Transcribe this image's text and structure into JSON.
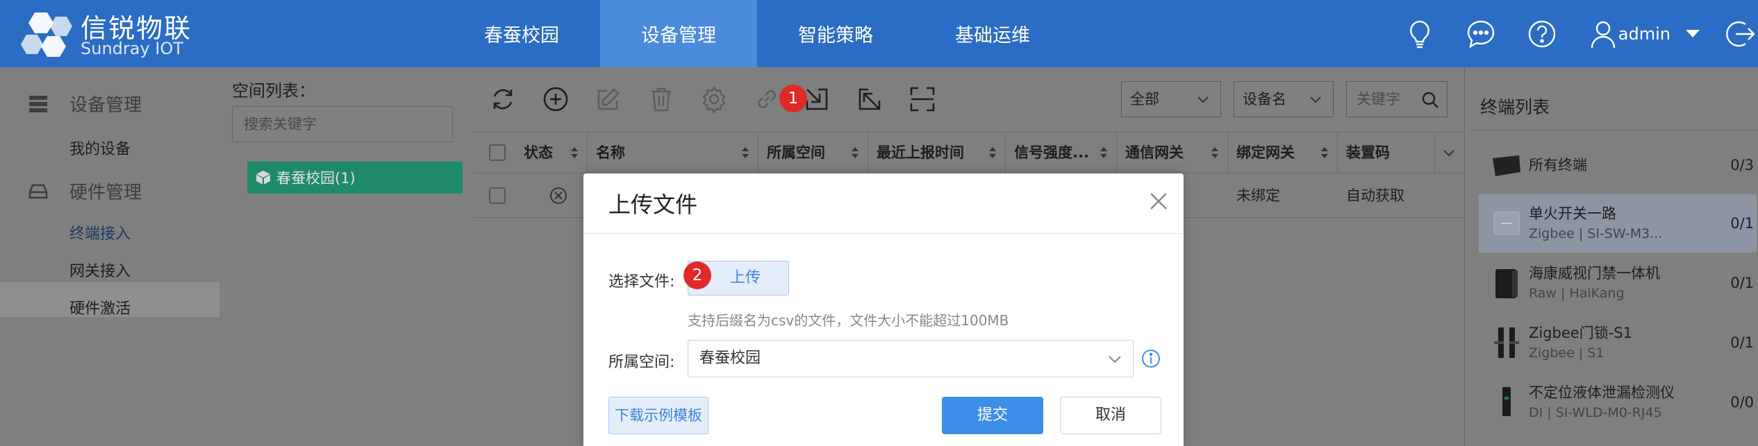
{
  "brand": {
    "name_cn": "信锐物联",
    "name_en": "Sundray IOT"
  },
  "nav": {
    "tabs": [
      {
        "label": "春蚕校园"
      },
      {
        "label": "设备管理",
        "active": true
      },
      {
        "label": "智能策略"
      },
      {
        "label": "基础运维"
      }
    ]
  },
  "header": {
    "user": "admin",
    "icons": [
      "lightbulb-icon",
      "chat-icon",
      "help-icon",
      "user-icon",
      "logout-icon"
    ]
  },
  "sidebar": {
    "groups": [
      {
        "label": "设备管理",
        "icon": "device-icon",
        "items": [
          {
            "label": "我的设备"
          }
        ]
      },
      {
        "label": "硬件管理",
        "icon": "hardware-icon",
        "items": [
          {
            "label": "终端接入",
            "active": true
          },
          {
            "label": "网关接入"
          },
          {
            "label": "硬件激活"
          }
        ]
      }
    ]
  },
  "space_panel": {
    "label": "空间列表：",
    "search_placeholder": "搜索关键字",
    "tree": [
      {
        "label": "春蚕校园(1)"
      }
    ]
  },
  "toolbar": {
    "icons": [
      "refresh-icon",
      "add-icon",
      "edit-icon",
      "delete-icon",
      "settings-icon",
      "link-icon",
      "import-icon",
      "export-icon",
      "scan-icon"
    ],
    "filter_all": "全部",
    "filter_field": "设备名",
    "keyword_placeholder": "关键字"
  },
  "table": {
    "columns": [
      "状态",
      "名称",
      "所属空间",
      "最近上报时间",
      "信号强度...",
      "通信网关",
      "绑定网关",
      "装置码"
    ],
    "rows": [
      {
        "status_icon": "offline-icon",
        "name": "",
        "space": "",
        "last_report": "",
        "signal": "",
        "comm_gateway": "",
        "bind_gateway": "未绑定",
        "device_code": "自动获取"
      }
    ]
  },
  "terminal_panel": {
    "title": "终端列表",
    "items": [
      {
        "name": "所有终端",
        "sub": "",
        "count": "0/3",
        "icon": "folder-icon"
      },
      {
        "name": "单火开关一路",
        "sub": "Zigbee | SI-SW-M3...",
        "count": "0/1",
        "icon": "switch-icon",
        "selected": true
      },
      {
        "name": "海康威视门禁一体机",
        "sub": "Raw | HaiKang",
        "count": "0/1",
        "icon": "access-control-icon"
      },
      {
        "name": "Zigbee门锁-S1",
        "sub": "Zigbee | S1",
        "count": "0/1",
        "icon": "door-lock-icon"
      },
      {
        "name": "不定位液体泄漏检测仪",
        "sub": "DI | SI-WLD-M0-RJ45",
        "count": "0/0",
        "icon": "leak-detector-icon"
      }
    ]
  },
  "modal": {
    "title": "上传文件",
    "file_label": "选择文件:",
    "upload_label": "上传",
    "hint": "支持后缀名为csv的文件，文件大小不能超过100MB",
    "space_label": "所属空间:",
    "space_value": "春蚕校园",
    "template_label": "下载示例模板",
    "submit_label": "提交",
    "cancel_label": "取消"
  },
  "badges": {
    "first": "1",
    "second": "2"
  },
  "colors": {
    "header_bg": "#2b6cc4",
    "active_tab": "#4a8bdc",
    "primary": "#3d8ee8",
    "badge": "#e02a2a",
    "tree_node": "#1e8a6a"
  }
}
